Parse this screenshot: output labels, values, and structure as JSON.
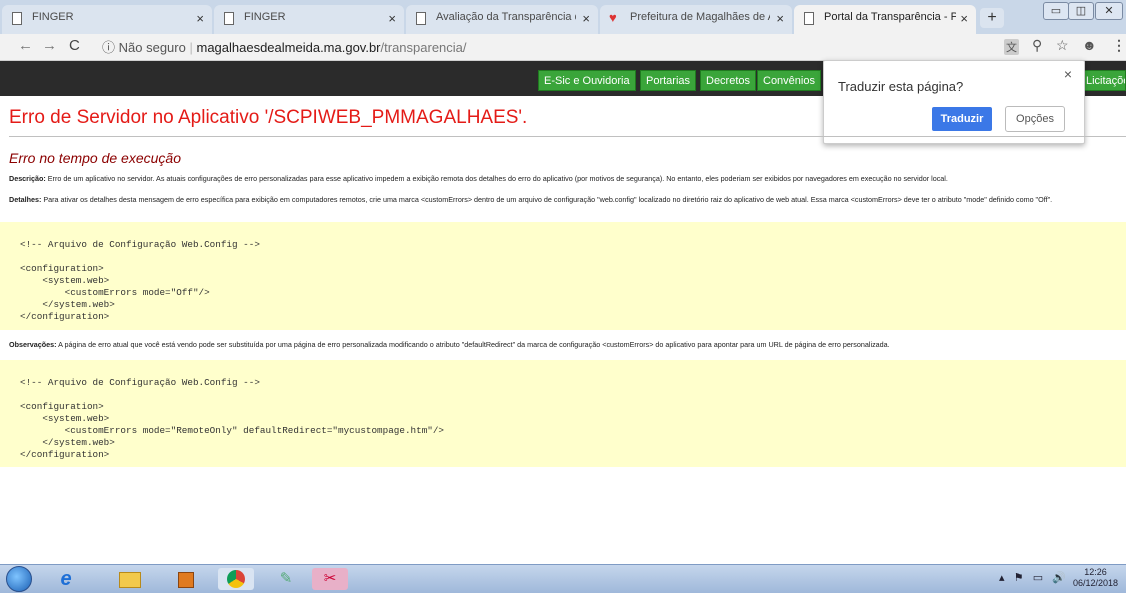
{
  "browser": {
    "tabs": [
      {
        "label": "FINGER",
        "favicon": "page-icon"
      },
      {
        "label": "FINGER",
        "favicon": "page-icon"
      },
      {
        "label": "Avaliação da Transparência dos",
        "favicon": "page-icon"
      },
      {
        "label": "Prefeitura de Magalhães de Alm",
        "favicon": "red-logo-icon"
      },
      {
        "label": "Portal da Transparência - Prefei",
        "favicon": "page-icon"
      }
    ],
    "tab_close_glyph": "×",
    "new_tab_glyph": "+",
    "security_label": "Não seguro",
    "url_host": "magalhaesdealmeida.ma.gov.br",
    "url_path": "/transparencia/"
  },
  "site_nav": {
    "items": [
      "E-Sic e Ouvidoria",
      "Portarias",
      "Decretos",
      "Convênios",
      "Licitações"
    ],
    "color": "#3aa53a"
  },
  "translate_popup": {
    "title": "Traduzir esta página?",
    "translate_label": "Traduzir",
    "options_label": "Opções",
    "close_glyph": "×"
  },
  "page": {
    "title": "Erro de Servidor no Aplicativo '/SCPIWEB_PMMAGALHAES'.",
    "subtitle": "Erro no tempo de execução",
    "description_label": "Descrição:",
    "description_text": "Erro de um aplicativo no servidor. As atuais configurações de erro personalizadas para esse aplicativo impedem a exibição remota dos detalhes do erro do aplicativo (por motivos de segurança). No entanto, eles poderiam ser exibidos por navegadores em execução no servidor local.",
    "details_label": "Detalhes:",
    "details_text": "Para ativar os detalhes desta mensagem de erro específica para exibição em computadores remotos, crie uma marca <customErrors> dentro de um arquivo de configuração \"web.config\" localizado no diretório raiz do aplicativo de web atual. Essa marca <customErrors> deve ter o atributo \"mode\" definido como \"Off\".",
    "code1": "<!-- Arquivo de Configuração Web.Config -->\n\n<configuration>\n    <system.web>\n        <customErrors mode=\"Off\"/>\n    </system.web>\n</configuration>",
    "notes_label": "Observações:",
    "notes_text": "A página de erro atual que você está vendo pode ser substituída por uma página de erro personalizada modificando o atributo \"defaultRedirect\" da marca de configuração <customErrors> do aplicativo para apontar para um URL de página de erro personalizada.",
    "code2": "<!-- Arquivo de Configuração Web.Config -->\n\n<configuration>\n    <system.web>\n        <customErrors mode=\"RemoteOnly\" defaultRedirect=\"mycustompage.htm\"/>\n    </system.web>\n</configuration>",
    "title_color": "#e41b17",
    "code_bg": "#ffffcc"
  },
  "taskbar": {
    "time": "12:26",
    "date": "06/12/2018"
  }
}
